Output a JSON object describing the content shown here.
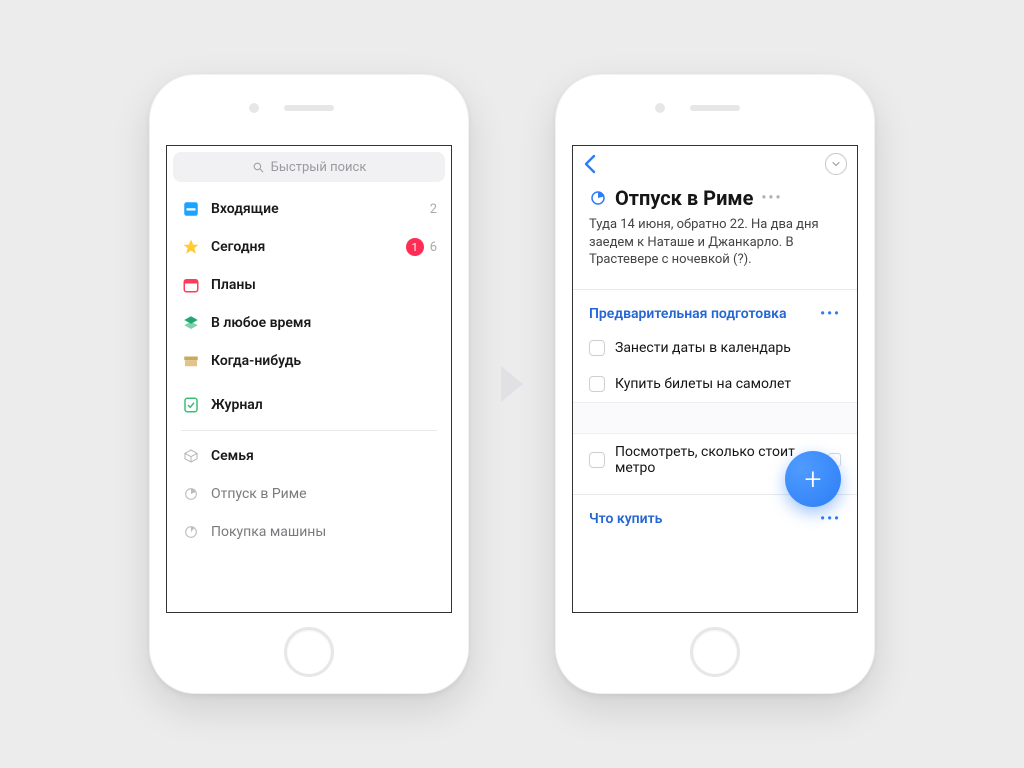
{
  "left": {
    "search_placeholder": "Быстрый поиск",
    "items": [
      {
        "label": "Входящие",
        "count": "2"
      },
      {
        "label": "Сегодня",
        "badge": "1",
        "count": "6"
      },
      {
        "label": "Планы"
      },
      {
        "label": "В любое время"
      },
      {
        "label": "Когда-нибудь"
      },
      {
        "label": "Журнал"
      }
    ],
    "area": {
      "label": "Семья"
    },
    "projects": [
      {
        "label": "Отпуск в Риме"
      },
      {
        "label": "Покупка машины"
      }
    ]
  },
  "right": {
    "title": "Отпуск в Риме",
    "description": "Туда 14 июня, обратно 22. На два дня заедем к Наташе и Джанкарло. В Трастевере с ночевкой (?).",
    "sections": [
      {
        "heading": "Предварительная подготовка",
        "tasks": [
          "Занести даты в календарь",
          "Купить билеты на самолет",
          "Посмотреть, сколько стоит метро"
        ]
      },
      {
        "heading": "Что купить"
      }
    ]
  }
}
